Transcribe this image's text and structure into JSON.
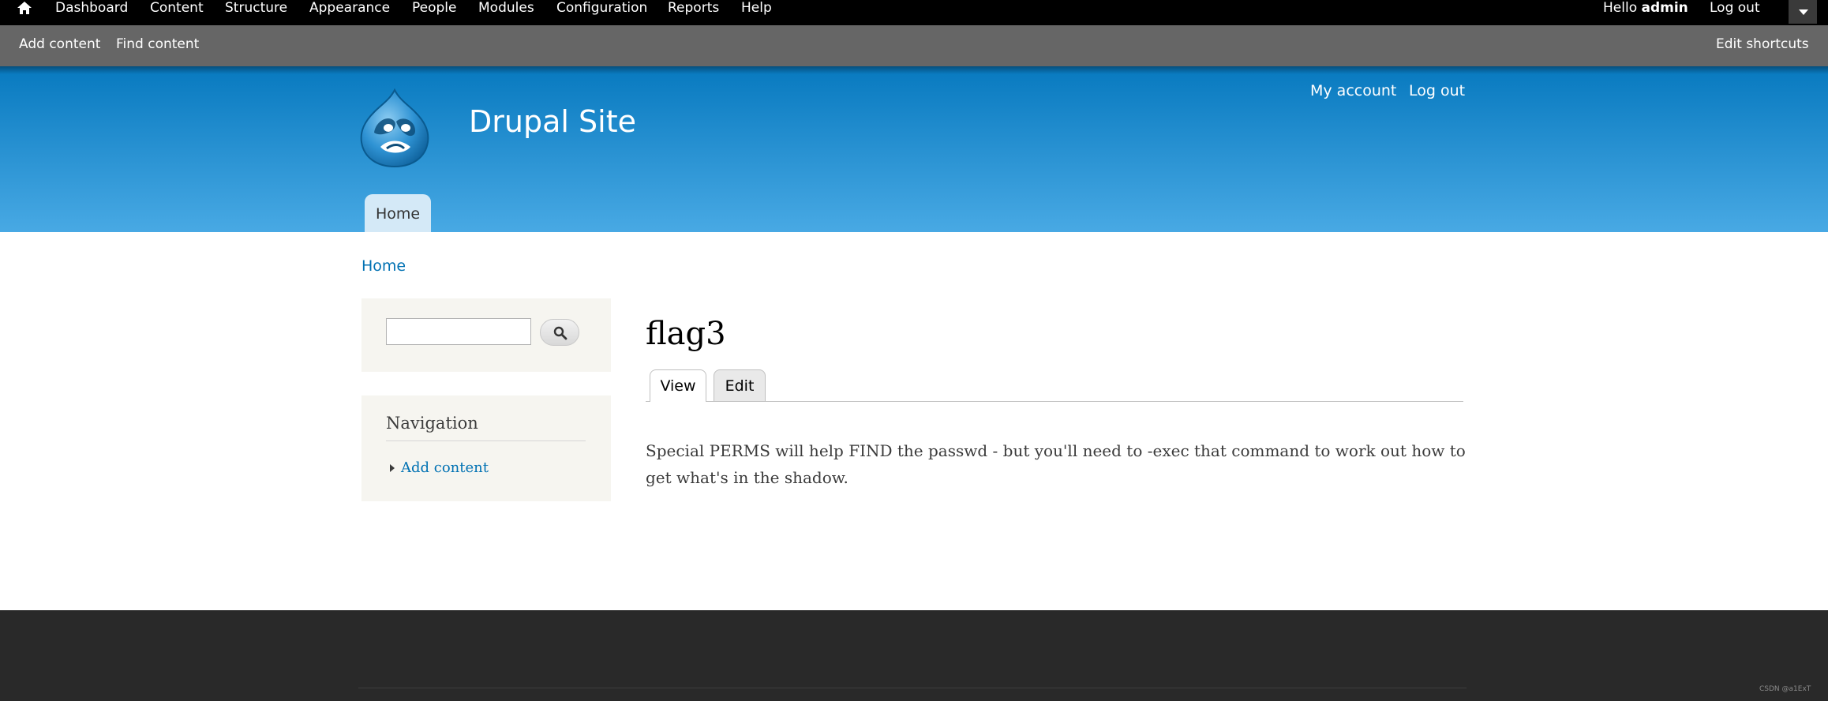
{
  "admin_toolbar": {
    "home_icon": "home-icon",
    "menu": [
      {
        "label": "Dashboard"
      },
      {
        "label": "Content"
      },
      {
        "label": "Structure"
      },
      {
        "label": "Appearance"
      },
      {
        "label": "People"
      },
      {
        "label": "Modules"
      },
      {
        "label": "Configuration"
      },
      {
        "label": "Reports"
      },
      {
        "label": "Help"
      }
    ],
    "hello_label": "Hello",
    "username": "admin",
    "logout_label": "Log out",
    "handle_icon": "chevron-down-icon"
  },
  "shortcuts": {
    "items": [
      {
        "label": "Add content"
      },
      {
        "label": "Find content"
      }
    ],
    "edit_label": "Edit shortcuts"
  },
  "header": {
    "logo_icon": "drupal-drop-logo",
    "site_name": "Drupal Site",
    "secondary_menu": [
      {
        "label": "My account"
      },
      {
        "label": "Log out"
      }
    ],
    "main_menu": [
      {
        "label": "Home",
        "active": true
      }
    ]
  },
  "breadcrumb": {
    "items": [
      {
        "label": "Home"
      }
    ]
  },
  "sidebar": {
    "search": {
      "value": "",
      "placeholder": "",
      "button_icon": "search-icon"
    },
    "navigation": {
      "title": "Navigation",
      "items": [
        {
          "label": "Add content"
        }
      ]
    }
  },
  "main": {
    "title": "flag3",
    "tabs": [
      {
        "label": "View",
        "active": true
      },
      {
        "label": "Edit",
        "active": false
      }
    ],
    "body": "Special PERMS will help FIND the passwd - but you'll need to -exec that command to work out how to get what's in the shadow."
  },
  "footer": {
    "watermark": "CSDN @a1ExT"
  },
  "colors": {
    "admin_bar": "#000000",
    "shortcut_bar": "#666666",
    "header_top": "#0779bf",
    "header_bottom": "#48a9e4",
    "link": "#0071b3",
    "sidebar_bg": "#f6f5f0",
    "footer_bg": "#292929"
  }
}
